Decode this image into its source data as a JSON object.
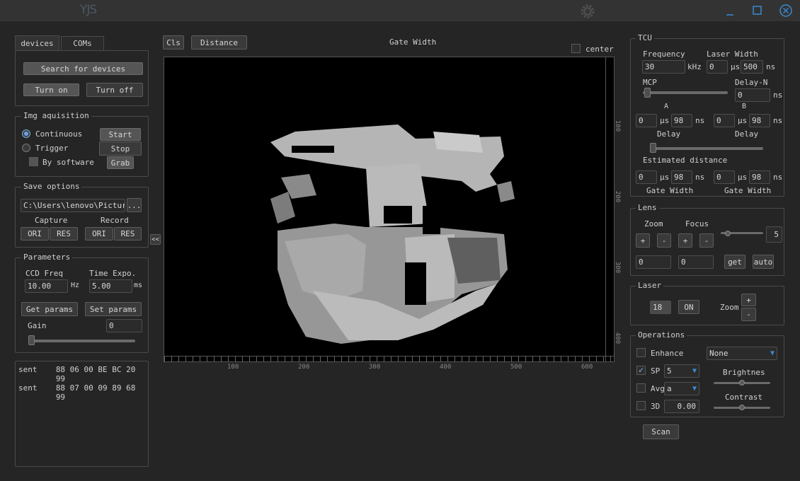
{
  "app": {
    "logo": "YJS"
  },
  "tabs": {
    "devices": "devices",
    "coms": "COMs"
  },
  "devices": {
    "search": "Search for devices",
    "turn_on": "Turn on",
    "turn_off": "Turn off"
  },
  "img": {
    "title": "Img aquisition",
    "continuous": "Continuous",
    "trigger": "Trigger",
    "by_software": "By software",
    "start": "Start",
    "stop": "Stop",
    "grab": "Grab"
  },
  "save": {
    "title": "Save options",
    "path": "C:\\Users\\lenovo\\Pictures",
    "browse": "...",
    "capture": "Capture",
    "record": "Record",
    "ori": "ORI",
    "res": "RES"
  },
  "params": {
    "title": "Parameters",
    "ccd_freq": "CCD Freq",
    "time_expo": "Time Expo.",
    "ccd_value": "10.00",
    "ccd_unit": "Hz",
    "expo_value": "5.00",
    "expo_unit": "ms",
    "get": "Get params",
    "set": "Set params",
    "gain": "Gain",
    "gain_value": "0"
  },
  "log": [
    {
      "dir": "sent",
      "bytes": "88 06 00 BE BC 20 99"
    },
    {
      "dir": "sent",
      "bytes": "88 07 00 09 89 68 99"
    }
  ],
  "collapse": "<<",
  "toolbar": {
    "cls": "Cls",
    "distance": "Distance",
    "view_title": "Gate Width",
    "center": "center"
  },
  "axes": {
    "x_ticks": [
      "100",
      "200",
      "300",
      "400",
      "500",
      "600"
    ],
    "y_ticks": [
      "100",
      "200",
      "300",
      "400"
    ]
  },
  "tcu": {
    "title": "TCU",
    "frequency": "Frequency",
    "freq_value": "30",
    "freq_unit": "kHz",
    "laser_width": "Laser Width",
    "lw_us": "0",
    "lw_ns": "500",
    "us": "μs",
    "ns": "ns",
    "mcp": "MCP",
    "delay_n": "Delay-N",
    "delay_n_value": "0",
    "a": "A",
    "b": "B",
    "a_us": "0",
    "a_ns": "98",
    "b_us": "0",
    "b_ns": "98",
    "delay": "Delay",
    "estimated": "Estimated distance",
    "gw_a_us": "0",
    "gw_a_ns": "98",
    "gw_b_us": "0",
    "gw_b_ns": "98",
    "gate_width": "Gate Width"
  },
  "lens": {
    "title": "Lens",
    "zoom": "Zoom",
    "focus": "Focus",
    "plus": "+",
    "minus": "-",
    "speed": "5",
    "zoom_value": "0",
    "focus_value": "0",
    "get": "get",
    "auto": "auto"
  },
  "laser": {
    "title": "Laser",
    "value": "18",
    "on": "ON",
    "zoom": "Zoom",
    "plus": "+",
    "minus": "-"
  },
  "ops": {
    "title": "Operations",
    "enhance": "Enhance",
    "enhance_mode": "None",
    "sp": "SP",
    "sp_value": "5",
    "avg": "Avg",
    "avg_value": "a",
    "three_d": "3D",
    "three_d_value": "0.00",
    "brightness": "Brightnes",
    "contrast": "Contrast"
  },
  "scan": "Scan"
}
